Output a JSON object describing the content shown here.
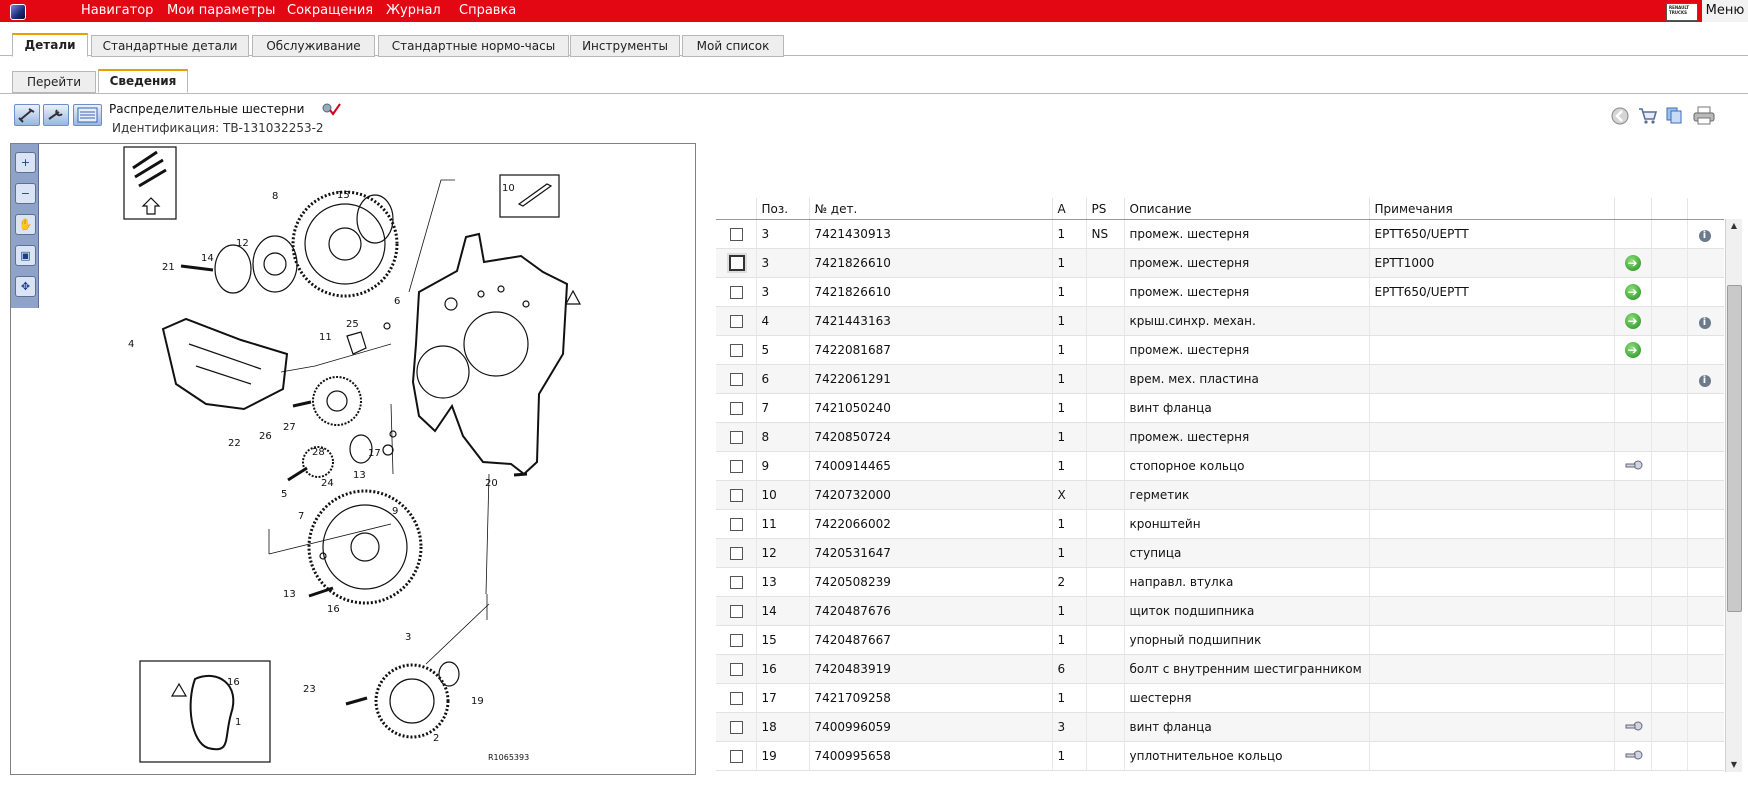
{
  "menu": [
    "Навигатор",
    "Мои параметры",
    "Сокращения",
    "Журнал",
    "Справка"
  ],
  "menu_button": "Меню",
  "tabs": [
    "Детали",
    "Стандартные детали",
    "Обслуживание",
    "Стандартные нормо-часы",
    "Инструменты",
    "Мой список"
  ],
  "subtabs": [
    "Перейти",
    "Сведения"
  ],
  "group": {
    "title": "Распределительные шестерни",
    "identification": "Идентификация: TB-131032253-2"
  },
  "diagram": {
    "reference": "R1065393",
    "callouts": [
      "1",
      "2",
      "3",
      "4",
      "5",
      "6",
      "7",
      "8",
      "9",
      "10",
      "11",
      "12",
      "13",
      "13",
      "14",
      "15",
      "16",
      "16",
      "17",
      "19",
      "20",
      "21",
      "22",
      "23",
      "24",
      "25",
      "26",
      "27",
      "28"
    ]
  },
  "table": {
    "headers": [
      "",
      "Поз.",
      "№ дет.",
      "A",
      "PS",
      "Описание",
      "Примечания",
      "",
      "",
      ""
    ],
    "rows": [
      {
        "pos": "3",
        "part": "7421430913",
        "a": "1",
        "ps": "NS",
        "desc": "промеж. шестерня",
        "note": "EPTT650/UEPTT",
        "action": "",
        "info": "i"
      },
      {
        "pos": "3",
        "part": "7421826610",
        "a": "1",
        "ps": "",
        "desc": "промеж. шестерня",
        "note": "EPTT1000",
        "action": "arrow",
        "info": ""
      },
      {
        "pos": "3",
        "part": "7421826610",
        "a": "1",
        "ps": "",
        "desc": "промеж. шестерня",
        "note": "EPTT650/UEPTT",
        "action": "arrow",
        "info": ""
      },
      {
        "pos": "4",
        "part": "7421443163",
        "a": "1",
        "ps": "",
        "desc": "крыш.синхр. механ.",
        "note": "",
        "action": "arrow",
        "info": "i"
      },
      {
        "pos": "5",
        "part": "7422081687",
        "a": "1",
        "ps": "",
        "desc": "промеж. шестерня",
        "note": "",
        "action": "arrow",
        "info": ""
      },
      {
        "pos": "6",
        "part": "7422061291",
        "a": "1",
        "ps": "",
        "desc": "врем. мех. пластина",
        "note": "",
        "action": "",
        "info": "i"
      },
      {
        "pos": "7",
        "part": "7421050240",
        "a": "1",
        "ps": "",
        "desc": "винт фланца",
        "note": "",
        "action": "",
        "info": ""
      },
      {
        "pos": "8",
        "part": "7420850724",
        "a": "1",
        "ps": "",
        "desc": "промеж. шестерня",
        "note": "",
        "action": "",
        "info": ""
      },
      {
        "pos": "9",
        "part": "7400914465",
        "a": "1",
        "ps": "",
        "desc": "стопорное кольцо",
        "note": "",
        "action": "key",
        "info": ""
      },
      {
        "pos": "10",
        "part": "7420732000",
        "a": "X",
        "ps": "",
        "desc": "герметик",
        "note": "",
        "action": "",
        "info": ""
      },
      {
        "pos": "11",
        "part": "7422066002",
        "a": "1",
        "ps": "",
        "desc": "кронштейн",
        "note": "",
        "action": "",
        "info": ""
      },
      {
        "pos": "12",
        "part": "7420531647",
        "a": "1",
        "ps": "",
        "desc": "ступица",
        "note": "",
        "action": "",
        "info": ""
      },
      {
        "pos": "13",
        "part": "7420508239",
        "a": "2",
        "ps": "",
        "desc": "направл. втулка",
        "note": "",
        "action": "",
        "info": ""
      },
      {
        "pos": "14",
        "part": "7420487676",
        "a": "1",
        "ps": "",
        "desc": "щиток подшипника",
        "note": "",
        "action": "",
        "info": ""
      },
      {
        "pos": "15",
        "part": "7420487667",
        "a": "1",
        "ps": "",
        "desc": "упорный подшипник",
        "note": "",
        "action": "",
        "info": ""
      },
      {
        "pos": "16",
        "part": "7420483919",
        "a": "6",
        "ps": "",
        "desc": "болт с внутренним шестигранником",
        "note": "",
        "action": "",
        "info": ""
      },
      {
        "pos": "17",
        "part": "7421709258",
        "a": "1",
        "ps": "",
        "desc": "шестерня",
        "note": "",
        "action": "",
        "info": ""
      },
      {
        "pos": "18",
        "part": "7400996059",
        "a": "3",
        "ps": "",
        "desc": "винт фланца",
        "note": "",
        "action": "key",
        "info": ""
      },
      {
        "pos": "19",
        "part": "7400995658",
        "a": "1",
        "ps": "",
        "desc": "уплотнительное кольцо",
        "note": "",
        "action": "key",
        "info": ""
      }
    ]
  },
  "colors": {
    "menu_bar": "#e30613",
    "active_tab_accent": "#e8a000",
    "zoom_bar": "#8fa3c9",
    "arrow_icon": "#1e8a1e"
  },
  "icons": [
    "app-logo-icon",
    "tool-icon",
    "wrench-icon",
    "list-icon",
    "edit-check-icon",
    "back-icon",
    "cart-icon",
    "copy-icon",
    "print-icon",
    "zoom-in-icon",
    "zoom-out-icon",
    "pan-hand-icon",
    "fit-icon",
    "fit-all-icon",
    "arrow-right-icon",
    "info-icon",
    "key-icon"
  ]
}
